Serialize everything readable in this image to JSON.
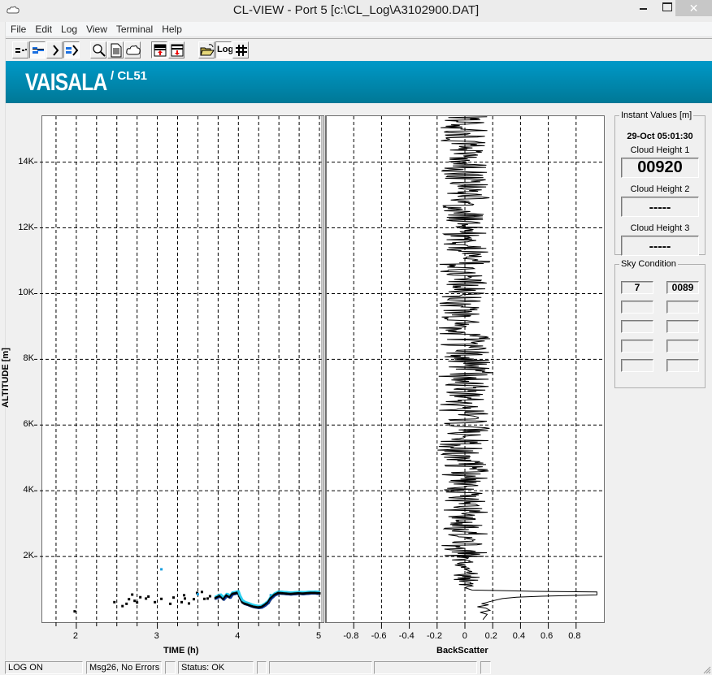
{
  "window": {
    "title": "CL-VIEW - Port 5  [c:\\CL_Log\\A3102900.DAT]",
    "close_glyph": "✕"
  },
  "menu": [
    "File",
    "Edit",
    "Log",
    "View",
    "Terminal",
    "Help"
  ],
  "toolbar": {
    "buttons": [
      {
        "name": "disconnect-icon",
        "pressed": false
      },
      {
        "name": "connect-icon",
        "pressed": true
      },
      {
        "name": "terminal-prompt-icon",
        "pressed": false
      },
      {
        "name": "data-prompt-icon",
        "pressed": true
      },
      {
        "name": "search-icon",
        "pressed": false
      },
      {
        "name": "document-icon",
        "pressed": false
      },
      {
        "name": "cloud-icon",
        "pressed": false
      },
      {
        "name": "save-up-icon",
        "pressed": false
      },
      {
        "name": "save-down-icon",
        "pressed": false
      },
      {
        "name": "open-folder-icon",
        "pressed": false
      },
      {
        "name": "log-icon",
        "pressed": true,
        "label": "Log"
      },
      {
        "name": "grid-icon",
        "pressed": false
      }
    ]
  },
  "banner": {
    "brand": "VAISALA",
    "model": "/ CL51",
    "color_top": "#0099c8",
    "color_bottom": "#007896"
  },
  "chart_data": [
    {
      "type": "scatter",
      "title": "",
      "xlabel": "TIME (h)",
      "ylabel": "ALTITUDE [m]",
      "xlim": [
        1.58,
        5.05
      ],
      "ylim": [
        0,
        15400
      ],
      "x_ticks": [
        2,
        3,
        4,
        5
      ],
      "x_tick_labels": [
        "2",
        "3",
        "4",
        "5"
      ],
      "x_minor_step": 0.25,
      "y_ticks": [
        2000,
        4000,
        6000,
        8000,
        10000,
        12000,
        14000
      ],
      "y_tick_labels": [
        "2K",
        "4K",
        "6K",
        "8K",
        "10K",
        "12K",
        "14K"
      ],
      "grid": true,
      "series": [
        {
          "name": "cloud-hits",
          "color": "#000000",
          "points": [
            [
              1.98,
              330
            ],
            [
              2.47,
              610
            ],
            [
              2.57,
              490
            ],
            [
              2.62,
              560
            ],
            [
              2.65,
              700
            ],
            [
              2.69,
              840
            ],
            [
              2.72,
              650
            ],
            [
              2.75,
              600
            ],
            [
              2.79,
              760
            ],
            [
              2.86,
              720
            ],
            [
              2.89,
              780
            ],
            [
              2.97,
              610
            ],
            [
              3.05,
              710
            ],
            [
              3.16,
              560
            ],
            [
              3.2,
              750
            ],
            [
              3.3,
              610
            ],
            [
              3.33,
              820
            ],
            [
              3.34,
              720
            ],
            [
              3.39,
              570
            ],
            [
              3.45,
              700
            ],
            [
              3.49,
              890
            ],
            [
              3.55,
              920
            ],
            [
              3.58,
              710
            ],
            [
              3.62,
              720
            ],
            [
              3.65,
              790
            ],
            [
              3.72,
              730
            ],
            [
              3.78,
              800
            ],
            [
              3.82,
              700
            ],
            [
              3.86,
              820
            ],
            [
              3.9,
              760
            ],
            [
              3.93,
              860
            ],
            [
              3.97,
              880
            ],
            [
              4.0,
              900
            ],
            [
              4.02,
              760
            ],
            [
              4.05,
              620
            ],
            [
              4.08,
              570
            ],
            [
              4.12,
              540
            ],
            [
              4.16,
              500
            ],
            [
              4.2,
              470
            ],
            [
              4.25,
              450
            ],
            [
              4.29,
              460
            ],
            [
              4.33,
              520
            ],
            [
              4.37,
              600
            ],
            [
              4.4,
              720
            ],
            [
              4.45,
              830
            ],
            [
              4.5,
              890
            ],
            [
              4.55,
              880
            ],
            [
              4.6,
              870
            ],
            [
              4.65,
              860
            ],
            [
              4.7,
              870
            ],
            [
              4.75,
              880
            ],
            [
              4.8,
              870
            ],
            [
              4.85,
              880
            ],
            [
              4.9,
              890
            ],
            [
              4.95,
              890
            ],
            [
              5.0,
              880
            ]
          ]
        },
        {
          "name": "cloud-hits-weak",
          "color": "#1aa0e0",
          "points": [
            [
              3.05,
              1610
            ],
            [
              3.5,
              850
            ],
            [
              3.75,
              780
            ],
            [
              3.98,
              920
            ],
            [
              4.4,
              820
            ],
            [
              4.65,
              900
            ],
            [
              4.95,
              930
            ]
          ]
        }
      ]
    },
    {
      "type": "line",
      "title": "",
      "xlabel": "BackScatter",
      "ylabel": "",
      "xlim": [
        -1.0,
        1.0
      ],
      "ylim": [
        0,
        15400
      ],
      "x_ticks": [
        -0.8,
        -0.6,
        -0.4,
        -0.2,
        0,
        0.2,
        0.4,
        0.6,
        0.8
      ],
      "x_tick_labels": [
        "-0.8",
        "-0.6",
        "-0.4",
        "-0.2",
        "0",
        "0.2",
        "0.4",
        "0.6",
        "0.8"
      ],
      "grid": true,
      "series": [
        {
          "name": "backscatter-profile",
          "color": "#000000",
          "noise_amplitude_by_altitude": [
            [
              1000,
              0.06
            ],
            [
              2000,
              0.1
            ],
            [
              5000,
              0.16
            ],
            [
              9000,
              0.18
            ],
            [
              15400,
              0.16
            ]
          ],
          "points": [
            [
              0.13,
              80
            ],
            [
              0.16,
              240
            ],
            [
              0.11,
              300
            ],
            [
              0.18,
              360
            ],
            [
              0.15,
              430
            ],
            [
              0.09,
              470
            ],
            [
              0.17,
              530
            ],
            [
              0.12,
              560
            ],
            [
              0.2,
              650
            ],
            [
              0.27,
              720
            ],
            [
              0.37,
              760
            ],
            [
              0.55,
              790
            ],
            [
              0.95,
              830
            ],
            [
              0.95,
              920
            ],
            [
              0.5,
              940
            ],
            [
              0.05,
              980
            ],
            [
              0.0,
              1050
            ]
          ]
        }
      ]
    }
  ],
  "instant_values": {
    "legend": "Instant Values [m]",
    "timestamp": "29-Oct 05:01:30",
    "cloud_heights": [
      {
        "label": "Cloud Height 1",
        "value": "00920"
      },
      {
        "label": "Cloud Height 2",
        "value": "-----"
      },
      {
        "label": "Cloud Height 3",
        "value": "-----"
      }
    ]
  },
  "sky_condition": {
    "legend": "Sky Condition",
    "rows": [
      [
        "7",
        "0089"
      ],
      [
        "",
        ""
      ],
      [
        "",
        ""
      ],
      [
        "",
        ""
      ],
      [
        "",
        ""
      ]
    ]
  },
  "status_bar": [
    "LOG ON",
    "Msg26, No Errors",
    "",
    "Status: OK",
    "",
    "",
    "",
    "",
    ""
  ]
}
